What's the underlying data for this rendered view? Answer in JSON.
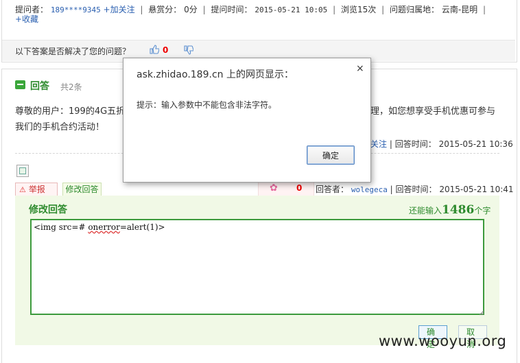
{
  "question": {
    "asker_label": "提问者：",
    "asker_name": "189****9345",
    "follow": "+加关注",
    "reward_label": "悬赏分：",
    "reward_value": "0分",
    "time_label": "提问时间：",
    "time_value": "2015-05-21 10:05",
    "views": "浏览15次",
    "region_label": "问题归属地：",
    "region_value": "云南-昆明",
    "favorite": "+收藏"
  },
  "resolved": {
    "text": "以下答案是否解决了您的问题？",
    "up_count": "0"
  },
  "answer": {
    "title": "回答",
    "count": "共2条",
    "body_line1a": "尊敬的用户：199的4G五折",
    "body_line1b": "理，如您想享受手机优惠可参与",
    "body_line2": "我们的手机合约活动！",
    "meta1_follow": "关注",
    "meta1_time_label": "回答时间：",
    "meta1_time": "2015-05-21 10:36",
    "report": "举报",
    "modify": "修改回答",
    "flower_count": "0",
    "answerer_label": "回答者：",
    "answerer_name": "wolegeca",
    "meta2_time_label": "回答时间：",
    "meta2_time": "2015-05-21 10:41"
  },
  "edit": {
    "title": "修改回答",
    "remaining_prefix": "还能输入",
    "remaining_count": "1486",
    "remaining_suffix": "个字",
    "content_a": "<img src=# ",
    "content_b": "onerror",
    "content_c": "=alert(1)>",
    "confirm": "确 定",
    "cancel": "取 消"
  },
  "dialog": {
    "title": "ask.zhidao.189.cn 上的网页显示：",
    "close": "×",
    "message": "提示：输入参数中不能包含非法字符。",
    "ok": "确定"
  },
  "watermark": "www.wooyun.org",
  "colors": {
    "green": "#2e8b2e",
    "blue_link": "#2a5fb0",
    "red": "#e00000"
  }
}
